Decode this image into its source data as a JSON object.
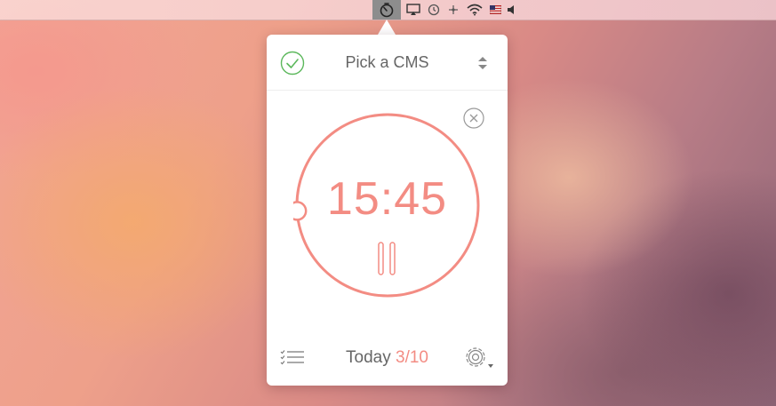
{
  "menubar": {
    "icons": [
      "timer-icon",
      "airplay-icon",
      "time-machine-icon",
      "network-icon",
      "wifi-icon",
      "flag-icon",
      "volume-icon"
    ]
  },
  "popover": {
    "task_name": "Pick a CMS",
    "timer": "15:45",
    "progress_fraction": 0.26,
    "today_label": "Today",
    "today_count": "3/10"
  },
  "colors": {
    "accent": "#f38c83",
    "check_green": "#5cb85c",
    "track_gray": "#aaaaaa",
    "text_gray": "#666666"
  }
}
